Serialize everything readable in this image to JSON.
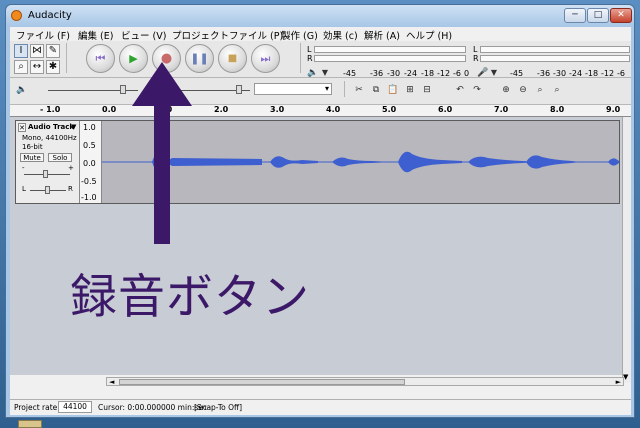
{
  "window": {
    "title": "Audacity",
    "minimize": "─",
    "maximize": "□",
    "close": "✕"
  },
  "menu": [
    "ファイル (F)",
    "編集 (E)",
    "ビュー (V)",
    "プロジェクトファイル (P)",
    "製作 (G)",
    "効果 (c)",
    "解析 (A)",
    "ヘルプ (H)"
  ],
  "transport": {
    "skip_start_icon": "skip-start-icon",
    "play_icon": "play-icon",
    "record_icon": "record-icon",
    "pause_icon": "pause-icon",
    "stop_icon": "stop-icon",
    "skip_end_icon": "skip-end-icon"
  },
  "meters": {
    "playback": {
      "L": "L",
      "R": "R"
    },
    "record": {
      "L": "L",
      "R": "R"
    },
    "scale1": [
      "-45",
      "-36",
      "-30",
      "-24",
      "-18",
      "-12",
      "-6",
      "0"
    ],
    "scale2": [
      "-45",
      "-36",
      "-30",
      "-24",
      "-18",
      "-12",
      "-6"
    ]
  },
  "ruler": [
    "- 1.0",
    "0.0",
    "1.0",
    "2.0",
    "3.0",
    "4.0",
    "5.0",
    "6.0",
    "7.0",
    "8.0",
    "9.0"
  ],
  "track": {
    "name": "Audio Track",
    "info1": "Mono, 44100Hz",
    "info2": "16-bit",
    "mute": "Mute",
    "solo": "Solo",
    "gain_minus": "-",
    "gain_plus": "+",
    "pan_l": "L",
    "pan_r": "R",
    "scale": [
      "1.0",
      "0.5",
      "0.0",
      "-0.5",
      "-1.0"
    ]
  },
  "status": {
    "rate_label": "Project rate:",
    "rate_value": "44100",
    "cursor": "Cursor: 0:00.000000 min:sec",
    "snap": "[Snap-To Off]"
  },
  "annotation": "録音ボタン",
  "colors": {
    "waveform": "#3d5fd0",
    "arrow": "#3b1868",
    "record_dot": "#c86a6a",
    "play": "#2fa52f"
  }
}
